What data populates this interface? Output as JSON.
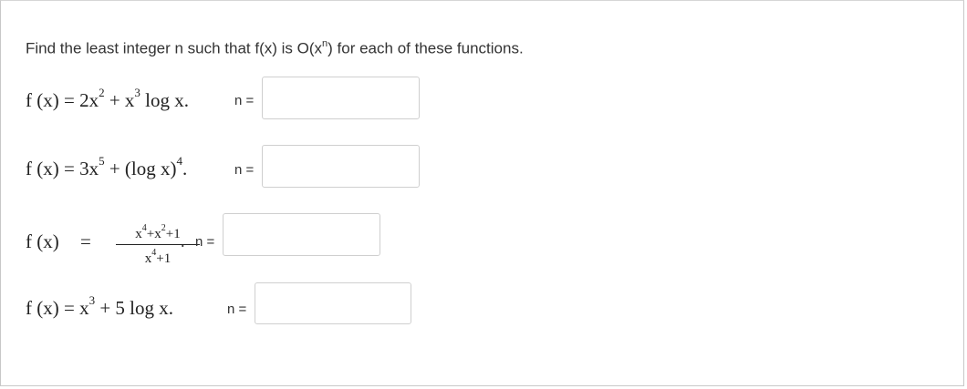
{
  "prompt": {
    "text_before": "Find the least integer n such that f(x) is O(x",
    "sup": "n",
    "text_after": ") for each of these functions."
  },
  "items": [
    {
      "lhs": "f (x) = ",
      "expr_parts": [
        "2x",
        "2",
        " + x",
        "3",
        " log x."
      ],
      "label": "n =",
      "value": ""
    },
    {
      "lhs": "f (x) = ",
      "expr_parts": [
        "3x",
        "5",
        " + (log x)",
        "4",
        "."
      ],
      "label": "n =",
      "value": ""
    },
    {
      "lhs": "f (x)",
      "eq": "=",
      "numerator": [
        "x",
        "4",
        "+x",
        "2",
        "+1"
      ],
      "denominator": [
        "x",
        "4",
        "+1"
      ],
      "after": ".",
      "label": "n =",
      "value": ""
    },
    {
      "lhs": "f (x) = ",
      "expr_parts": [
        "x",
        "3",
        " + 5 log x."
      ],
      "label": "n =",
      "value": ""
    }
  ]
}
